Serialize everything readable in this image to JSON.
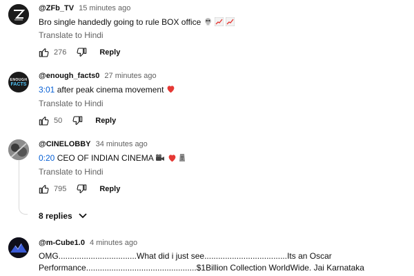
{
  "comments": [
    {
      "handle": "@ZFb_TV",
      "time": "15 minutes ago",
      "text": "Bro single handedly going to rule BOX office",
      "translate": "Translate to Hindi",
      "likes": "276",
      "reply": "Reply"
    },
    {
      "handle": "@enough_facts0",
      "time": "27 minutes ago",
      "timestamp": "3:01",
      "text": " after peak cinema movement",
      "avatar_text_top": "ENOUGH",
      "avatar_text_bottom": "FACTS",
      "translate": "Translate to Hindi",
      "likes": "50",
      "reply": "Reply"
    },
    {
      "handle": "@CINELOBBY",
      "time": "34 minutes ago",
      "timestamp": "0:20",
      "text": " CEO OF INDIAN CINEMA",
      "translate": "Translate to Hindi",
      "likes": "795",
      "reply": "Reply",
      "replies": "8 replies"
    },
    {
      "handle": "@m-Cube1.0",
      "time": "4 minutes ago",
      "line1": "OMG..................................What did i just see....................................Its an Oscar",
      "line2": "Performance................................................$1Billion Collection WorldWide. Jai Karnataka"
    }
  ],
  "colors": {
    "link": "#065fd4",
    "secondary": "#606060",
    "heart": "#e53935"
  },
  "icons": [
    "thumb-up-icon",
    "thumb-down-icon",
    "chevron-down-icon",
    "skull-icon",
    "chart-up-icon",
    "heart-icon",
    "movie-camera-icon",
    "moai-icon"
  ]
}
